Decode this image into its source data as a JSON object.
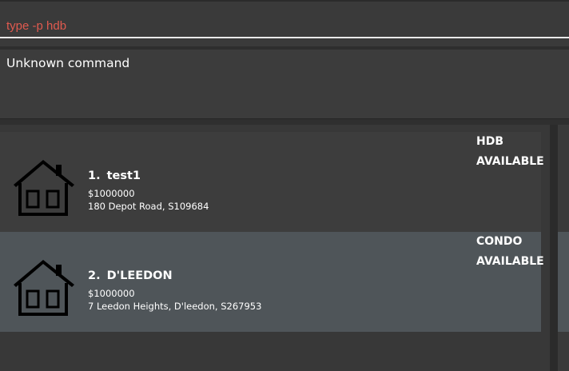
{
  "command_box": {
    "value": "type -p hdb"
  },
  "result_display": {
    "message": "Unknown command"
  },
  "listings": [
    {
      "index": "1.",
      "name": "test1",
      "price": "$1000000",
      "address": "180 Depot Road, S109684",
      "type": "HDB",
      "status": "AVAILABLE",
      "icon": "house-icon"
    },
    {
      "index": "2.",
      "name": "D'LEEDON",
      "price": "$1000000",
      "address": "7 Leedon Heights, D'leedon, S267953",
      "type": "CONDO",
      "status": "AVAILABLE",
      "icon": "house-icon"
    }
  ],
  "colors": {
    "background": "#383838",
    "command_text": "#e05a4f",
    "selected_card": "#4f5559",
    "card": "#3d3d3d",
    "text": "#ffffff"
  }
}
